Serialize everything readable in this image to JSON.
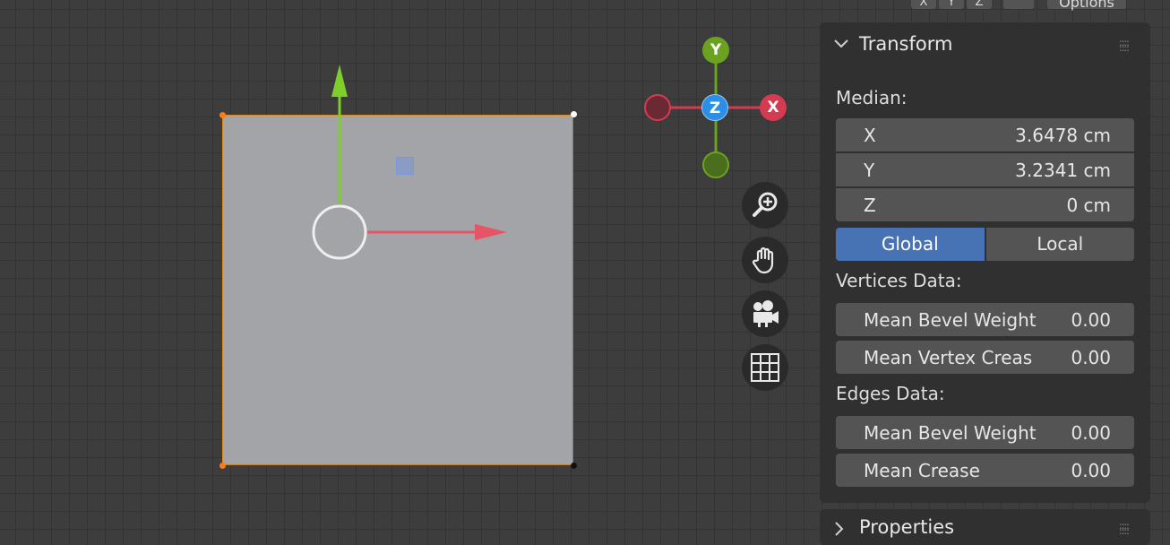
{
  "toolbar": {
    "icon1": "ꟲꟲ",
    "btn_x": "X",
    "btn_y": "Y",
    "btn_z": "Z",
    "options_label": "Options"
  },
  "gizmo": {
    "x_label": "X",
    "y_label": "Y",
    "z_label": "Z",
    "colors": {
      "x": "#d43b50",
      "y": "#6ba21f",
      "z": "#2b8fe6"
    }
  },
  "colors": {
    "selected_edge": "#e08a22",
    "move_x": "#e65565",
    "move_y": "#7fcf2a",
    "face": "#a3a4a7",
    "toggle_active": "#4772b3"
  },
  "transform_panel": {
    "title": "Transform",
    "median_label": "Median:",
    "median": {
      "x_label": "X",
      "x_value": "3.6478 cm",
      "y_label": "Y",
      "y_value": "3.2341 cm",
      "z_label": "Z",
      "z_value": "0 cm"
    },
    "space_toggle": {
      "global": "Global",
      "local": "Local",
      "active": "Global"
    },
    "vertices_data_label": "Vertices Data:",
    "vertices": {
      "bevel_label": "Mean Bevel Weight",
      "bevel_value": "0.00",
      "crease_label": "Mean Vertex Creas",
      "crease_value": "0.00"
    },
    "edges_data_label": "Edges Data:",
    "edges": {
      "bevel_label": "Mean Bevel Weight",
      "bevel_value": "0.00",
      "crease_label": "Mean Crease",
      "crease_value": "0.00"
    }
  },
  "properties_panel": {
    "title": "Properties"
  }
}
